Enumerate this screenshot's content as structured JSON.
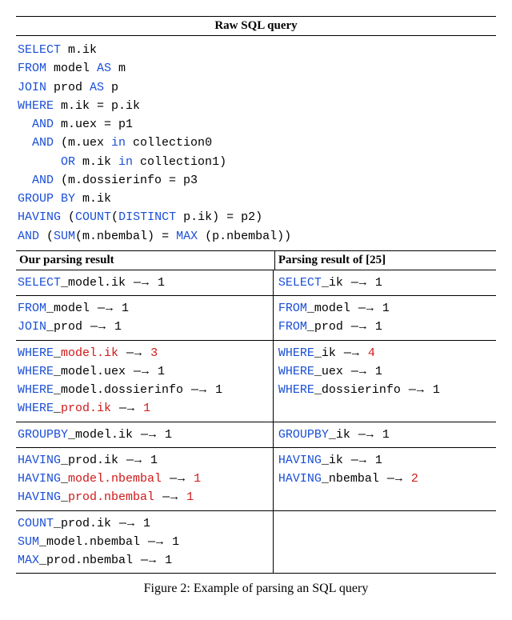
{
  "header": "Raw SQL query",
  "sql": {
    "l1_kw1": "SELECT",
    "l1_txt": " m.ik",
    "l2_kw1": "FROM",
    "l2_txt1": " model ",
    "l2_kw2": "AS",
    "l2_txt2": " m",
    "l3_kw1": "JOIN",
    "l3_txt1": " prod ",
    "l3_kw2": "AS",
    "l3_txt2": " p",
    "l4_kw1": "WHERE",
    "l4_txt1": " m.ik = p.ik",
    "l5_kw1": "  AND",
    "l5_txt1": " m.uex = p1",
    "l6_kw1": "  AND",
    "l6_txt1": " (m.uex ",
    "l6_kw2": "in",
    "l6_txt2": " collection0",
    "l7_kw1": "      OR",
    "l7_txt1": " m.ik ",
    "l7_kw2": "in",
    "l7_txt2": " collection1)",
    "l8_kw1": "  AND",
    "l8_txt1": " (m.dossierinfo = p3",
    "l9_kw1": "GROUP BY",
    "l9_txt1": " m.ik",
    "l10_kw1": "HAVING",
    "l10_txt1": " (",
    "l10_kw2": "COUNT",
    "l10_txt2": "(",
    "l10_kw3": "DISTINCT",
    "l10_txt3": " p.ik) = p2)",
    "l11_kw1": "AND",
    "l11_txt1": " (",
    "l11_kw2": "SUM",
    "l11_txt2": "(m.nbembal) = ",
    "l11_kw3": "MAX",
    "l11_txt3": " (p.nbembal))"
  },
  "col_left_header": "Our parsing result",
  "col_right_header": "Parsing result of [25]",
  "arrow": " —→ ",
  "groups": {
    "g1": {
      "left": [
        {
          "kw": "SELECT",
          "mid": "_model.ik",
          "count": "1",
          "red": false
        }
      ],
      "right": [
        {
          "kw": "SELECT",
          "mid": "_ik",
          "count": "1",
          "red": false
        }
      ]
    },
    "g2": {
      "left": [
        {
          "kw": "FROM",
          "mid": "_model",
          "count": "1",
          "red": false
        },
        {
          "kw": "JOIN",
          "mid": "_prod",
          "count": "1",
          "red": false
        }
      ],
      "right": [
        {
          "kw": "FROM",
          "mid": "_model",
          "count": "1",
          "red": false
        },
        {
          "kw": "FROM",
          "mid": "_prod",
          "count": "1",
          "red": false
        }
      ]
    },
    "g3": {
      "left": [
        {
          "kw": "WHERE",
          "mid": "_",
          "redmid": "model.ik",
          "count": "3",
          "redcount": true
        },
        {
          "kw": "WHERE",
          "mid": "_model.uex",
          "count": "1",
          "red": false
        },
        {
          "kw": "WHERE",
          "mid": "_model.dossierinfo",
          "count": "1",
          "red": false
        },
        {
          "kw": "WHERE",
          "mid": "_",
          "redmid": "prod.ik",
          "count": "1",
          "redcount": true
        }
      ],
      "right": [
        {
          "kw": "WHERE",
          "mid": "_ik",
          "count": "4",
          "redcount": true
        },
        {
          "kw": "WHERE",
          "mid": "_uex",
          "count": "1",
          "red": false
        },
        {
          "kw": "WHERE",
          "mid": "_dossierinfo",
          "count": "1",
          "red": false
        }
      ]
    },
    "g4": {
      "left": [
        {
          "kw": "GROUPBY",
          "mid": "_model.ik",
          "count": "1",
          "red": false
        }
      ],
      "right": [
        {
          "kw": "GROUPBY",
          "mid": "_ik",
          "count": "1",
          "red": false
        }
      ]
    },
    "g5": {
      "left": [
        {
          "kw": "HAVING",
          "mid": "_prod.ik",
          "count": "1",
          "red": false
        },
        {
          "kw": "HAVING",
          "mid": "_",
          "redmid": "model.nbembal",
          "count": "1",
          "redcount": true
        },
        {
          "kw": "HAVING",
          "mid": "_",
          "redmid": "prod.nbembal",
          "count": "1",
          "redcount": true
        }
      ],
      "right": [
        {
          "kw": "HAVING",
          "mid": "_ik",
          "count": "1",
          "red": false
        },
        {
          "kw": "HAVING",
          "mid": "_nbembal",
          "count": "2",
          "redcount": true
        }
      ]
    },
    "g6": {
      "left": [
        {
          "kw": "COUNT",
          "mid": "_prod.ik",
          "count": "1",
          "red": false
        },
        {
          "kw": "SUM",
          "mid": "_model.nbembal",
          "count": "1",
          "red": false
        },
        {
          "kw": "MAX",
          "mid": "_prod.nbembal",
          "count": "1",
          "red": false
        }
      ],
      "right": []
    }
  },
  "caption": "Figure 2: Example of parsing an SQL query"
}
